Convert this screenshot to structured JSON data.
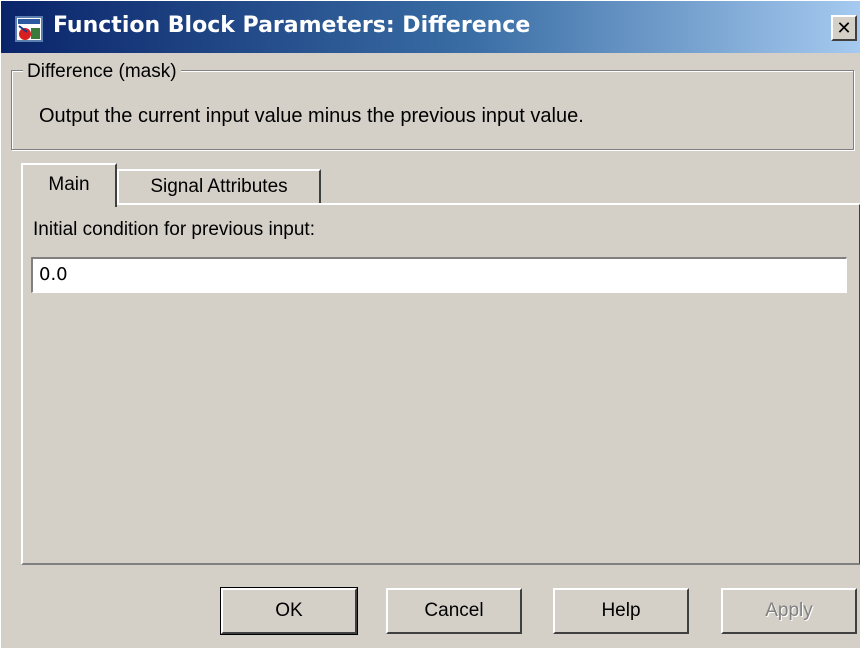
{
  "window": {
    "title": "Function Block Parameters: Difference",
    "close_label": "✕",
    "icon": "simulink-block-icon"
  },
  "mask": {
    "group_label": "Difference (mask)",
    "description": "Output the current input value minus the previous input value."
  },
  "tabs": [
    {
      "label": "Main",
      "selected": true
    },
    {
      "label": "Signal Attributes",
      "selected": false
    }
  ],
  "main": {
    "initial_condition_label": "Initial condition for previous input:",
    "initial_condition_value": "0.0"
  },
  "buttons": {
    "ok": "OK",
    "cancel": "Cancel",
    "help": "Help",
    "apply": "Apply"
  },
  "colors": {
    "titlebar_start": "#0a246a",
    "titlebar_end": "#a6caf0",
    "face": "#d4d0c8"
  }
}
